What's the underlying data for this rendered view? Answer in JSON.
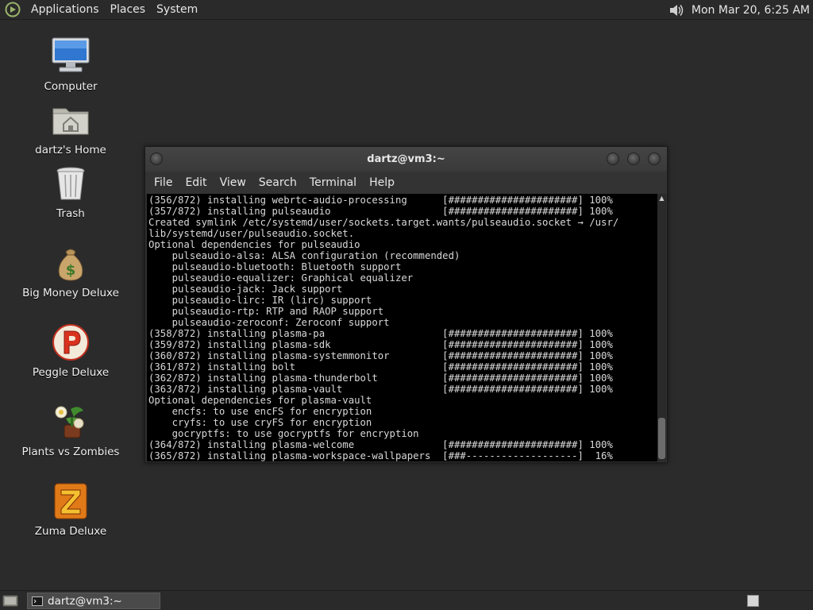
{
  "top_panel": {
    "menus": [
      "Applications",
      "Places",
      "System"
    ],
    "volume_icon": "speaker-icon",
    "clock": "Mon Mar 20,  6:25 AM"
  },
  "desktop_icons": [
    {
      "label": "Computer",
      "icon": "computer-icon"
    },
    {
      "label": "dartz's Home",
      "icon": "home-folder-icon"
    },
    {
      "label": "Trash",
      "icon": "trash-icon"
    },
    {
      "label": "Big Money Deluxe",
      "icon": "money-bag-icon"
    },
    {
      "label": "Peggle Deluxe",
      "icon": "peggle-icon"
    },
    {
      "label": "Plants vs Zombies",
      "icon": "plants-vs-zombies-icon"
    },
    {
      "label": "Zuma Deluxe",
      "icon": "zuma-icon"
    }
  ],
  "terminal": {
    "title": "dartz@vm3:~",
    "menus": [
      "File",
      "Edit",
      "View",
      "Search",
      "Terminal",
      "Help"
    ],
    "lines": [
      "(356/872) installing webrtc-audio-processing      [######################] 100%",
      "(357/872) installing pulseaudio                   [######################] 100%",
      "Created symlink /etc/systemd/user/sockets.target.wants/pulseaudio.socket → /usr/",
      "lib/systemd/user/pulseaudio.socket.",
      "Optional dependencies for pulseaudio",
      "    pulseaudio-alsa: ALSA configuration (recommended)",
      "    pulseaudio-bluetooth: Bluetooth support",
      "    pulseaudio-equalizer: Graphical equalizer",
      "    pulseaudio-jack: Jack support",
      "    pulseaudio-lirc: IR (lirc) support",
      "    pulseaudio-rtp: RTP and RAOP support",
      "    pulseaudio-zeroconf: Zeroconf support",
      "(358/872) installing plasma-pa                    [######################] 100%",
      "(359/872) installing plasma-sdk                   [######################] 100%",
      "(360/872) installing plasma-systemmonitor         [######################] 100%",
      "(361/872) installing bolt                         [######################] 100%",
      "(362/872) installing plasma-thunderbolt           [######################] 100%",
      "(363/872) installing plasma-vault                 [######################] 100%",
      "Optional dependencies for plasma-vault",
      "    encfs: to use encFS for encryption",
      "    cryfs: to use cryFS for encryption",
      "    gocryptfs: to use gocryptfs for encryption",
      "(364/872) installing plasma-welcome               [######################] 100%",
      "(365/872) installing plasma-workspace-wallpapers  [###-------------------]  16%"
    ]
  },
  "bottom_panel": {
    "task_label": "dartz@vm3:~",
    "show_desktop_icon": "show-desktop-icon",
    "workspace_icon": "workspace-switcher-icon"
  },
  "colors": {
    "desktop_bg": "#2b2b2b",
    "terminal_bg": "#000000",
    "terminal_fg": "#d8d8d8"
  }
}
